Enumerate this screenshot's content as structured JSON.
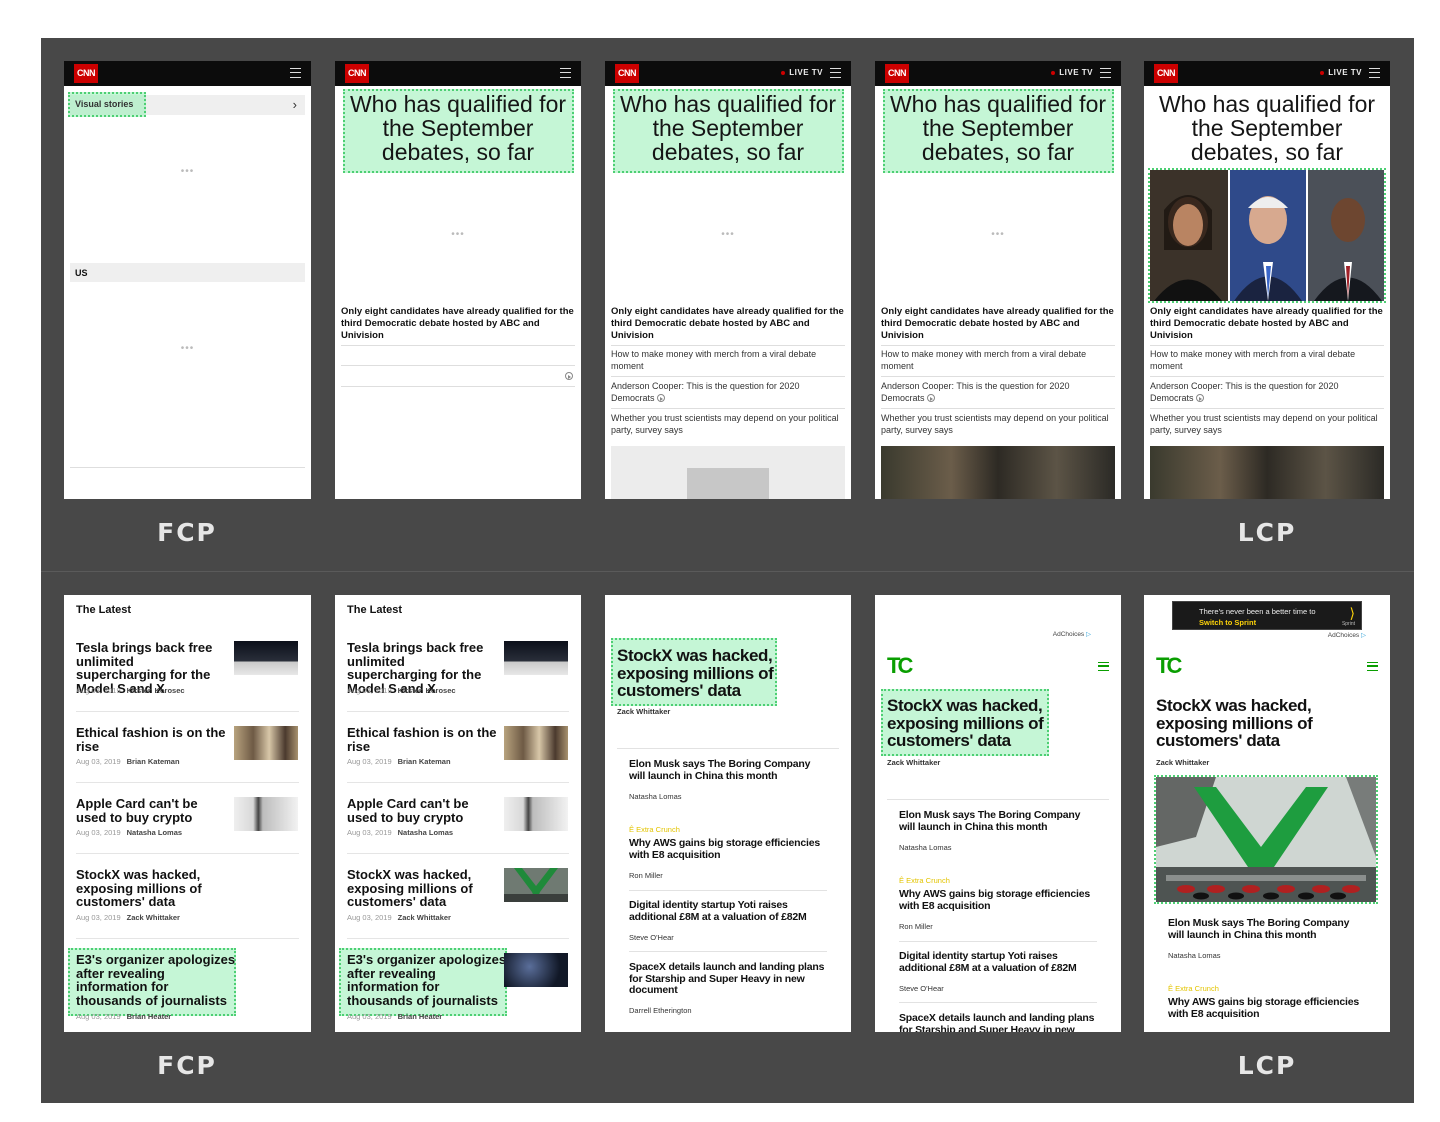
{
  "labels": {
    "fcp": "FCP",
    "lcp": "LCP"
  },
  "cnn": {
    "logo": "CNN",
    "live_tv": "LIVE TV",
    "visual_stories": "Visual stories",
    "us_section": "US",
    "ellipsis": "•••",
    "headline": "Who has qualified for the September debates, so far",
    "lead": "Only eight candidates have already qualified for the third Democratic debate hosted by ABC and Univision",
    "stories": [
      "How to make money with merch from a viral debate moment",
      "Anderson Cooper: This is the question for 2020 Democrats",
      "Whether you trust scientists may depend on your political party, survey says"
    ]
  },
  "latest": {
    "title": "The Latest",
    "items": [
      {
        "title": "Tesla brings back free unlimited supercharging for the Model S and X",
        "date": "Aug 03, 2019",
        "author": "Kirsten Korosec"
      },
      {
        "title": "Ethical fashion is on the rise",
        "date": "Aug 03, 2019",
        "author": "Brian Kateman"
      },
      {
        "title": "Apple Card can't be used to buy crypto",
        "date": "Aug 03, 2019",
        "author": "Natasha Lomas"
      },
      {
        "title": "StockX was hacked, exposing millions of customers' data",
        "date": "Aug 03, 2019",
        "author": "Zack Whittaker"
      },
      {
        "title": "E3's organizer apologizes after revealing information for thousands of journalists",
        "date": "Aug 03, 2019",
        "author": "Brian Heater"
      }
    ]
  },
  "tc": {
    "logo": "TC",
    "adchoices": "AdChoices",
    "ad_line1": "There's never been a better time to",
    "ad_line2": "Switch to Sprint",
    "ad_brand": "Sprint",
    "headline": "StockX was hacked, exposing millions of customers' data",
    "author": "Zack Whittaker",
    "extra_crunch": "Extra Crunch",
    "items": [
      {
        "title": "Elon Musk says The Boring Company will launch in China this month",
        "author": "Natasha Lomas"
      },
      {
        "title": "Why AWS gains big storage efficiencies with E8 acquisition",
        "author": "Ron Miller"
      },
      {
        "title": "Digital identity startup Yoti raises additional £8M at a valuation of £82M",
        "author": "Steve O'Hear"
      },
      {
        "title": "SpaceX details launch and landing plans for Starship and Super Heavy in new document",
        "author": "Darrell Etherington"
      }
    ]
  },
  "colors": {
    "highlight": "#96eeb4",
    "highlight_border": "#4dcf73",
    "cnn_red": "#cc0000",
    "tc_green": "#0a9e01",
    "panel_bg": "#484848"
  }
}
